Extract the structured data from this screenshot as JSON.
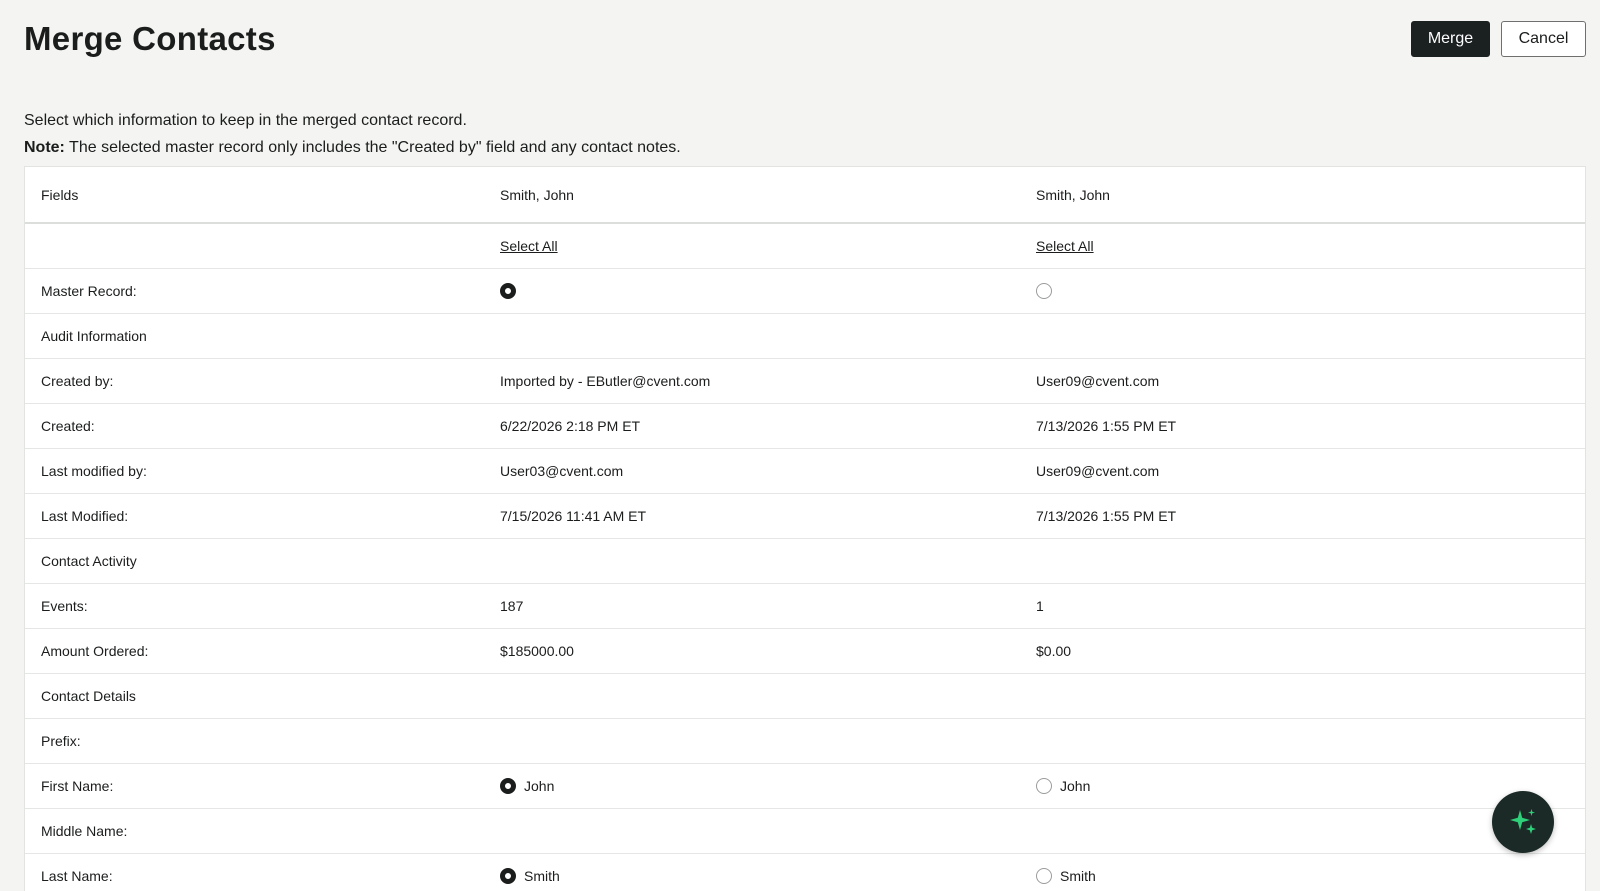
{
  "page": {
    "title": "Merge Contacts",
    "merge_label": "Merge",
    "cancel_label": "Cancel",
    "intro_line1": "Select which information to keep in the merged contact record.",
    "note_label": "Note:",
    "note_text": " The selected master record only includes the \"Created by\" field and any contact notes."
  },
  "table": {
    "headers": [
      "Fields",
      "Smith, John",
      "Smith, John"
    ],
    "select_all_label": "Select All",
    "rows": {
      "master_record": {
        "label": "Master Record:",
        "selected": 0
      },
      "audit_information": {
        "label": "Audit Information"
      },
      "created_by": {
        "label": "Created by:",
        "a": "Imported by - EButler@cvent.com",
        "b": "User09@cvent.com"
      },
      "created": {
        "label": "Created:",
        "a": "6/22/2026 2:18 PM ET",
        "b": "7/13/2026 1:55 PM ET"
      },
      "last_modified_by": {
        "label": "Last modified by:",
        "a": "User03@cvent.com",
        "b": "User09@cvent.com"
      },
      "last_modified": {
        "label": "Last Modified:",
        "a": "7/15/2026 11:41 AM ET",
        "b": "7/13/2026 1:55 PM ET"
      },
      "contact_activity": {
        "label": "Contact Activity"
      },
      "events": {
        "label": "Events:",
        "a": "187",
        "b": "1"
      },
      "amount_ordered": {
        "label": "Amount Ordered:",
        "a": "$185000.00",
        "b": "$0.00"
      },
      "contact_details": {
        "label": "Contact Details"
      },
      "prefix": {
        "label": "Prefix:"
      },
      "first_name": {
        "label": "First Name:",
        "a": "John",
        "b": "John",
        "selected": 0
      },
      "middle_name": {
        "label": "Middle Name:"
      },
      "last_name": {
        "label": "Last Name:",
        "a": "Smith",
        "b": "Smith",
        "selected": 0
      }
    }
  },
  "assistant": {
    "icon": "sparkle-icon",
    "accent": "#2fd07a"
  },
  "colors": {
    "primary_button": "#1b2020",
    "background": "#f4f5f3"
  }
}
